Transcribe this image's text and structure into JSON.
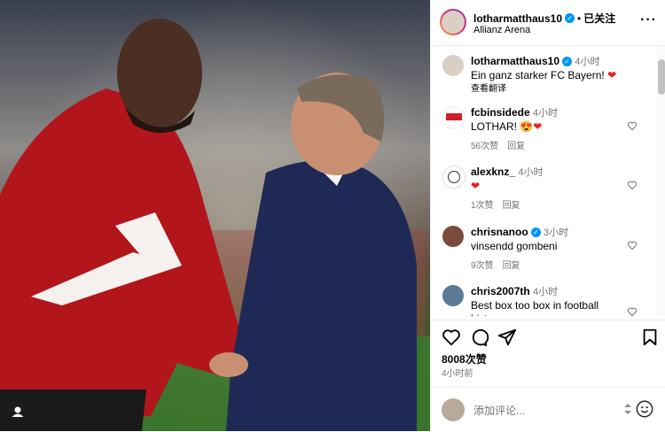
{
  "header": {
    "username": "lotharmatthaus10",
    "separator": "•",
    "follow_label": "已关注",
    "location": "Allianz Arena",
    "more_label": "···"
  },
  "comments": [
    {
      "user": "lotharmatthaus10",
      "verified": true,
      "time": "4小时",
      "text": "Ein ganz starker FC Bayern!",
      "emoji": "❤",
      "translate": "查看翻译"
    },
    {
      "user": "fcbinsidede",
      "verified": false,
      "time": "4小时",
      "text": "LOTHAR!",
      "emoji": "😍❤",
      "likes": "56次赞",
      "reply": "回复"
    },
    {
      "user": "alexknz_",
      "verified": false,
      "time": "4小时",
      "text": "",
      "emoji": "❤",
      "likes": "1次赞",
      "reply": "回复"
    },
    {
      "user": "chrisnanoo",
      "verified": true,
      "time": "3小时",
      "text": "vinsendd gombeni",
      "likes": "9次赞",
      "reply": "回复"
    },
    {
      "user": "chris2007th",
      "verified": false,
      "time": "4小时",
      "text": "Best box too box in football",
      "text2": "history"
    }
  ],
  "post": {
    "likes": "8008次赞",
    "time_ago": "4小时前"
  },
  "add_comment": {
    "placeholder": "添加评论..."
  },
  "colors": {
    "verified": "#0095f6",
    "heart": "#ed1c24",
    "jacket": "#b3151c",
    "suit": "#1e2a55"
  }
}
